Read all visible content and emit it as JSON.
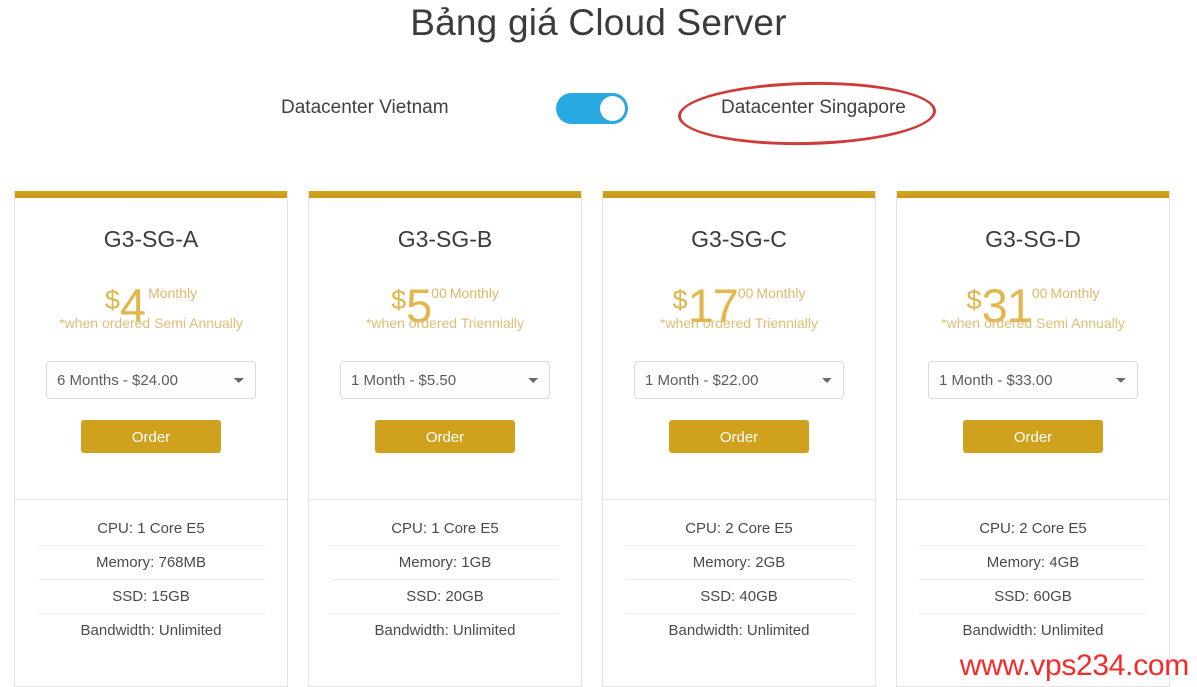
{
  "page": {
    "title": "Bảng giá Cloud Server",
    "watermark": "www.vps234.com"
  },
  "datacenter_switch": {
    "left_label": "Datacenter Vietnam",
    "right_label": "Datacenter Singapore",
    "toggle_state": "on",
    "highlight_color": "#cf3b36",
    "toggle_color": "#28a9e2"
  },
  "accent_color": "#cfa11c",
  "plans": [
    {
      "name": "G3-SG-A",
      "currency": "$",
      "amount": "4",
      "cents": "",
      "period": "Monthly",
      "note": "*when ordered Semi Annually",
      "term_selected": "6 Months - $24.00",
      "term_options": [
        "6 Months - $24.00"
      ],
      "order_label": "Order",
      "specs": [
        "CPU: 1 Core E5",
        "Memory: 768MB",
        "SSD: 15GB",
        "Bandwidth: Unlimited"
      ]
    },
    {
      "name": "G3-SG-B",
      "currency": "$",
      "amount": "5",
      "cents": "00",
      "period": "Monthly",
      "note": "*when ordered Triennially",
      "term_selected": "1 Month - $5.50",
      "term_options": [
        "1 Month - $5.50"
      ],
      "order_label": "Order",
      "specs": [
        "CPU: 1 Core E5",
        "Memory: 1GB",
        "SSD: 20GB",
        "Bandwidth: Unlimited"
      ]
    },
    {
      "name": "G3-SG-C",
      "currency": "$",
      "amount": "17",
      "cents": "00",
      "period": "Monthly",
      "note": "*when ordered Triennially",
      "term_selected": "1 Month - $22.00",
      "term_options": [
        "1 Month - $22.00"
      ],
      "order_label": "Order",
      "specs": [
        "CPU: 2 Core E5",
        "Memory: 2GB",
        "SSD: 40GB",
        "Bandwidth: Unlimited"
      ]
    },
    {
      "name": "G3-SG-D",
      "currency": "$",
      "amount": "31",
      "cents": "00",
      "period": "Monthly",
      "note": "*when ordered Semi Annually",
      "term_selected": "1 Month - $33.00",
      "term_options": [
        "1 Month - $33.00"
      ],
      "order_label": "Order",
      "specs": [
        "CPU: 2 Core E5",
        "Memory: 4GB",
        "SSD: 60GB",
        "Bandwidth: Unlimited"
      ]
    }
  ]
}
